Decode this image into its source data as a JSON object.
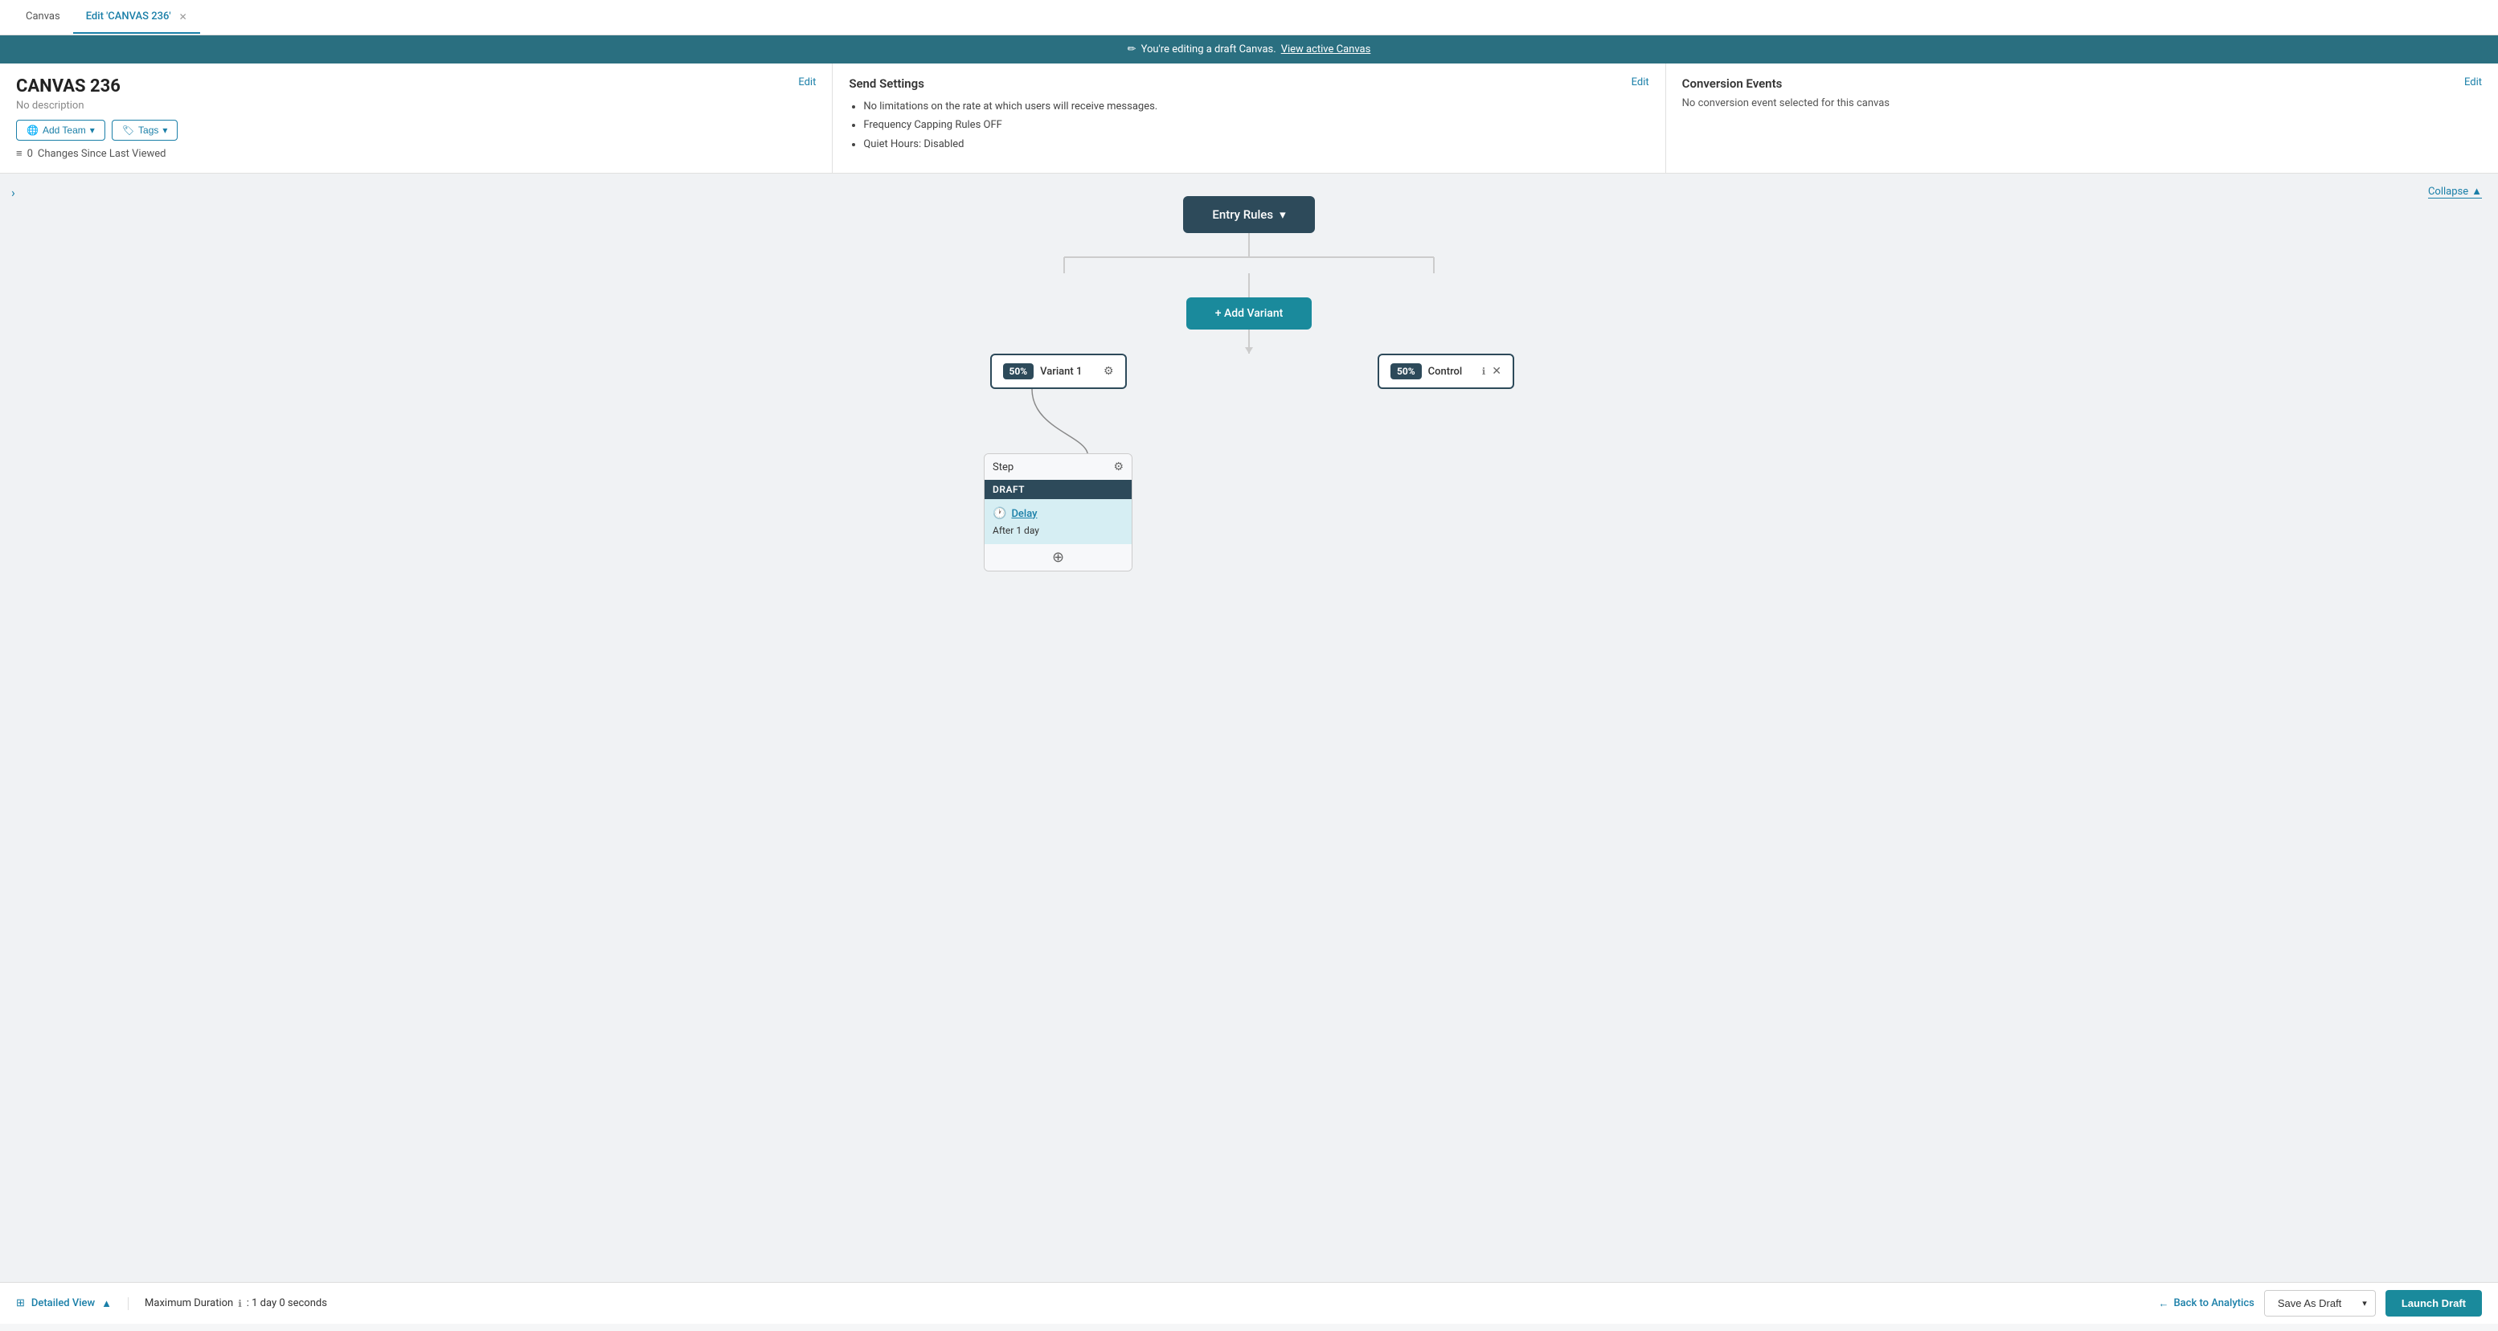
{
  "tabs": [
    {
      "id": "canvas",
      "label": "Canvas",
      "active": false
    },
    {
      "id": "edit-canvas-236",
      "label": "Edit 'CANVAS 236'",
      "active": true,
      "closable": true
    }
  ],
  "draft_banner": {
    "icon": "✏",
    "text": "You're editing a draft Canvas.",
    "link_text": "View active Canvas"
  },
  "canvas_info": {
    "title": "CANVAS 236",
    "description": "No description",
    "edit_label": "Edit",
    "add_team_label": "Add Team",
    "tags_label": "Tags",
    "changes_count": "0",
    "changes_label": "Changes Since Last Viewed"
  },
  "send_settings": {
    "title": "Send Settings",
    "edit_label": "Edit",
    "bullets": [
      "No limitations on the rate at which users will receive messages.",
      "Frequency Capping Rules OFF",
      "Quiet Hours: Disabled"
    ]
  },
  "conversion_events": {
    "title": "Conversion Events",
    "edit_label": "Edit",
    "text": "No conversion event selected for this canvas"
  },
  "canvas": {
    "collapse_label": "Collapse",
    "entry_rules_label": "Entry Rules",
    "add_variant_label": "+ Add Variant",
    "variants": [
      {
        "id": "variant1",
        "pct": "50%",
        "label": "Variant 1",
        "has_gear": true,
        "has_close": false
      },
      {
        "id": "control",
        "pct": "50%",
        "label": "Control",
        "has_info": true,
        "has_close": true
      }
    ],
    "step": {
      "label": "Step",
      "status": "DRAFT",
      "delay_label": "Delay",
      "delay_after": "After 1 day"
    }
  },
  "footer": {
    "detailed_view_label": "Detailed View",
    "max_duration_label": "Maximum Duration",
    "max_duration_value": ": 1 day 0 seconds",
    "back_to_analytics_label": "Back to Analytics",
    "save_as_draft_label": "Save As Draft",
    "launch_draft_label": "Launch Draft"
  }
}
